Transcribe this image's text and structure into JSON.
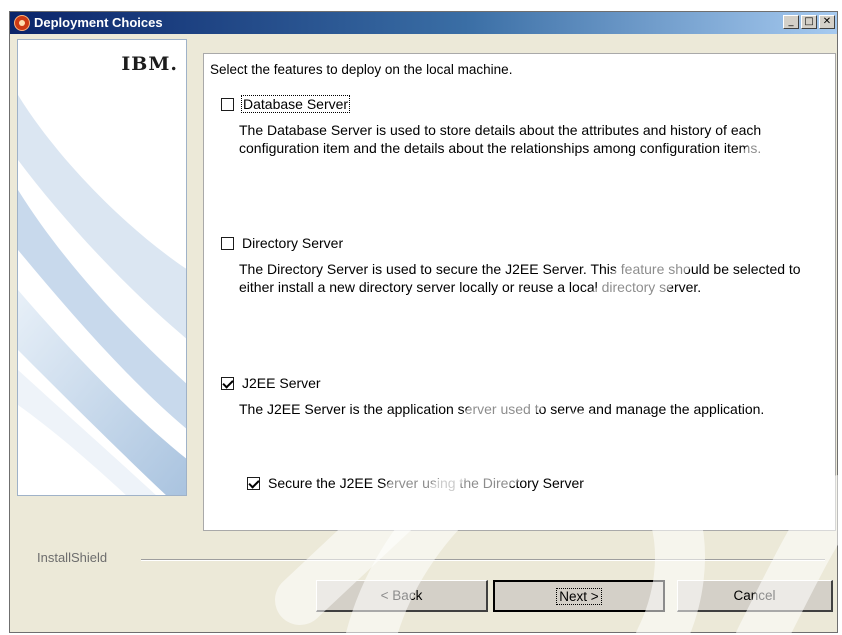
{
  "window": {
    "title": "Deployment Choices",
    "controls": {
      "minimize": "_",
      "maximize": "□",
      "close": "✕"
    }
  },
  "side_panel": {
    "logo_text": "IBM."
  },
  "main": {
    "intro": "Select the features to deploy on the local machine.",
    "features": [
      {
        "label": "Database Server",
        "checked": false,
        "description": "The Database Server is used to store details about the attributes and history of each configuration item and the details about the relationships among configuration items."
      },
      {
        "label": "Directory Server",
        "checked": false,
        "description": "The Directory Server is used to secure the J2EE Server. This feature should be selected to either install a new directory server locally or reuse a local directory server."
      },
      {
        "label": "J2EE Server",
        "checked": true,
        "description": "The J2EE Server is the application server used to serve and manage the application."
      }
    ],
    "sub_option": {
      "label": "Secure the J2EE Server using the Directory Server",
      "checked": true
    }
  },
  "footer": {
    "brand": "InstallShield",
    "back_label": "< Back",
    "next_label": "Next >",
    "cancel_label": "Cancel"
  },
  "colors": {
    "title_bar_start": "#0a246a",
    "title_bar_end": "#a6caf0",
    "dialog_background": "#ece9d8",
    "panel_swoosh": "#bcd0e6"
  },
  "icons": [
    "app-icon",
    "minimize-icon",
    "maximize-icon",
    "close-icon",
    "checkbox-icon"
  ]
}
